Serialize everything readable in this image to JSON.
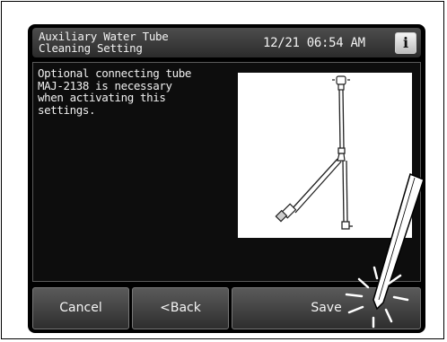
{
  "header": {
    "title_line1": "Auxiliary Water Tube",
    "title_line2": "Cleaning Setting",
    "datetime": "12/21 06:54 AM",
    "info_label": "i"
  },
  "message": {
    "line1": "Optional connecting tube",
    "line2": "MAJ-2138 is necessary",
    "line3": "when activating this",
    "line4": "settings."
  },
  "buttons": {
    "cancel": "Cancel",
    "back": "<Back",
    "save": "Save"
  },
  "icons": {
    "info": "info-icon",
    "illustration": "connecting-tube-illustration",
    "stylus": "stylus-pen-icon"
  }
}
